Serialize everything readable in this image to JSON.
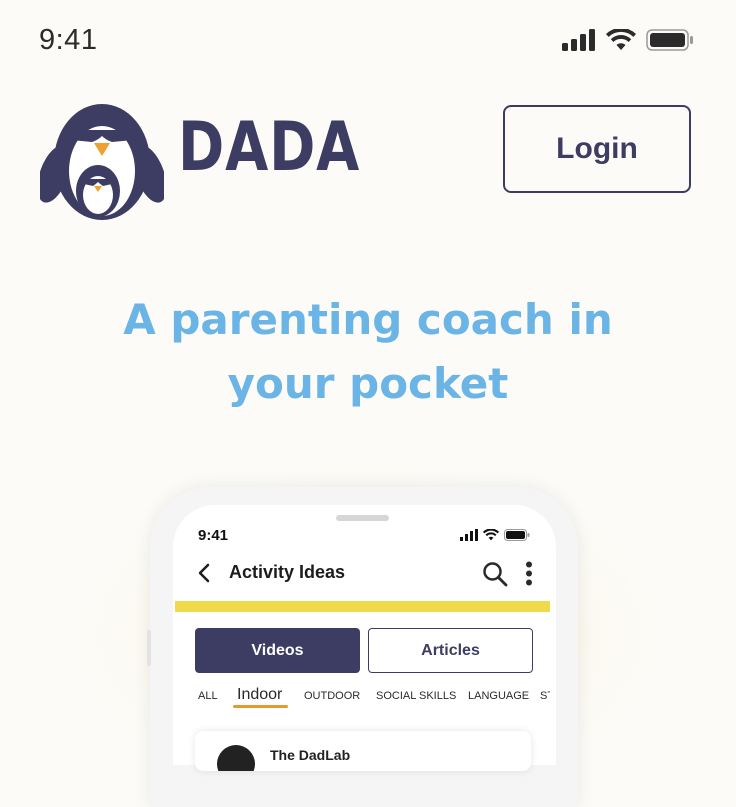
{
  "status_bar": {
    "time": "9:41"
  },
  "brand": {
    "name": "DADA"
  },
  "header": {
    "login_label": "Login"
  },
  "hero": {
    "tagline_line1": "A parenting coach in",
    "tagline_line2": "your pocket"
  },
  "phone": {
    "status_time": "9:41",
    "title": "Activity Ideas",
    "tabs": [
      {
        "label": "Videos"
      },
      {
        "label": "Articles"
      }
    ],
    "categories": [
      {
        "label": "ALL"
      },
      {
        "label": "Indoor"
      },
      {
        "label": "OUTDOOR"
      },
      {
        "label": "SOCIAL SKILLS"
      },
      {
        "label": "LANGUAGE"
      },
      {
        "label": "ST"
      }
    ],
    "card_title": "The DadLab"
  },
  "colors": {
    "brand_navy": "#3d3d63",
    "tagline_blue": "#6ab4e6",
    "accent_yellow": "#f0d94a",
    "accent_orange": "#e59a2e"
  },
  "icons": [
    "signal-icon",
    "wifi-icon",
    "battery-icon",
    "penguin-logo-icon",
    "back-chevron-icon",
    "search-icon",
    "kebab-menu-icon"
  ]
}
